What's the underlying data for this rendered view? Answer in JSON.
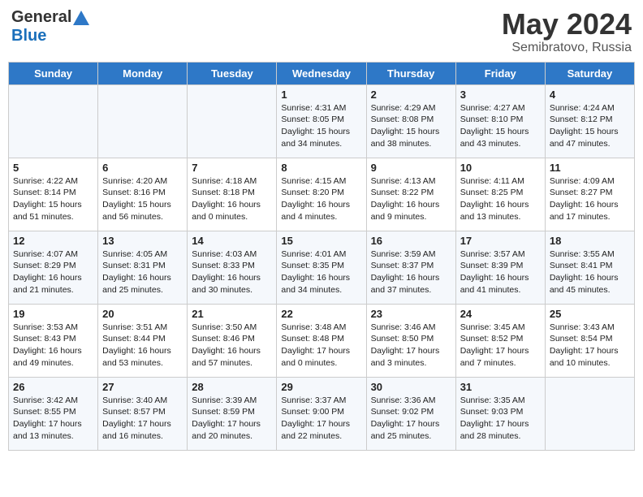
{
  "header": {
    "logo_general": "General",
    "logo_blue": "Blue",
    "month_year": "May 2024",
    "location": "Semibratovo, Russia"
  },
  "days_of_week": [
    "Sunday",
    "Monday",
    "Tuesday",
    "Wednesday",
    "Thursday",
    "Friday",
    "Saturday"
  ],
  "weeks": [
    [
      {
        "day": "",
        "info": ""
      },
      {
        "day": "",
        "info": ""
      },
      {
        "day": "",
        "info": ""
      },
      {
        "day": "1",
        "info": "Sunrise: 4:31 AM\nSunset: 8:05 PM\nDaylight: 15 hours\nand 34 minutes."
      },
      {
        "day": "2",
        "info": "Sunrise: 4:29 AM\nSunset: 8:08 PM\nDaylight: 15 hours\nand 38 minutes."
      },
      {
        "day": "3",
        "info": "Sunrise: 4:27 AM\nSunset: 8:10 PM\nDaylight: 15 hours\nand 43 minutes."
      },
      {
        "day": "4",
        "info": "Sunrise: 4:24 AM\nSunset: 8:12 PM\nDaylight: 15 hours\nand 47 minutes."
      }
    ],
    [
      {
        "day": "5",
        "info": "Sunrise: 4:22 AM\nSunset: 8:14 PM\nDaylight: 15 hours\nand 51 minutes."
      },
      {
        "day": "6",
        "info": "Sunrise: 4:20 AM\nSunset: 8:16 PM\nDaylight: 15 hours\nand 56 minutes."
      },
      {
        "day": "7",
        "info": "Sunrise: 4:18 AM\nSunset: 8:18 PM\nDaylight: 16 hours\nand 0 minutes."
      },
      {
        "day": "8",
        "info": "Sunrise: 4:15 AM\nSunset: 8:20 PM\nDaylight: 16 hours\nand 4 minutes."
      },
      {
        "day": "9",
        "info": "Sunrise: 4:13 AM\nSunset: 8:22 PM\nDaylight: 16 hours\nand 9 minutes."
      },
      {
        "day": "10",
        "info": "Sunrise: 4:11 AM\nSunset: 8:25 PM\nDaylight: 16 hours\nand 13 minutes."
      },
      {
        "day": "11",
        "info": "Sunrise: 4:09 AM\nSunset: 8:27 PM\nDaylight: 16 hours\nand 17 minutes."
      }
    ],
    [
      {
        "day": "12",
        "info": "Sunrise: 4:07 AM\nSunset: 8:29 PM\nDaylight: 16 hours\nand 21 minutes."
      },
      {
        "day": "13",
        "info": "Sunrise: 4:05 AM\nSunset: 8:31 PM\nDaylight: 16 hours\nand 25 minutes."
      },
      {
        "day": "14",
        "info": "Sunrise: 4:03 AM\nSunset: 8:33 PM\nDaylight: 16 hours\nand 30 minutes."
      },
      {
        "day": "15",
        "info": "Sunrise: 4:01 AM\nSunset: 8:35 PM\nDaylight: 16 hours\nand 34 minutes."
      },
      {
        "day": "16",
        "info": "Sunrise: 3:59 AM\nSunset: 8:37 PM\nDaylight: 16 hours\nand 37 minutes."
      },
      {
        "day": "17",
        "info": "Sunrise: 3:57 AM\nSunset: 8:39 PM\nDaylight: 16 hours\nand 41 minutes."
      },
      {
        "day": "18",
        "info": "Sunrise: 3:55 AM\nSunset: 8:41 PM\nDaylight: 16 hours\nand 45 minutes."
      }
    ],
    [
      {
        "day": "19",
        "info": "Sunrise: 3:53 AM\nSunset: 8:43 PM\nDaylight: 16 hours\nand 49 minutes."
      },
      {
        "day": "20",
        "info": "Sunrise: 3:51 AM\nSunset: 8:44 PM\nDaylight: 16 hours\nand 53 minutes."
      },
      {
        "day": "21",
        "info": "Sunrise: 3:50 AM\nSunset: 8:46 PM\nDaylight: 16 hours\nand 57 minutes."
      },
      {
        "day": "22",
        "info": "Sunrise: 3:48 AM\nSunset: 8:48 PM\nDaylight: 17 hours\nand 0 minutes."
      },
      {
        "day": "23",
        "info": "Sunrise: 3:46 AM\nSunset: 8:50 PM\nDaylight: 17 hours\nand 3 minutes."
      },
      {
        "day": "24",
        "info": "Sunrise: 3:45 AM\nSunset: 8:52 PM\nDaylight: 17 hours\nand 7 minutes."
      },
      {
        "day": "25",
        "info": "Sunrise: 3:43 AM\nSunset: 8:54 PM\nDaylight: 17 hours\nand 10 minutes."
      }
    ],
    [
      {
        "day": "26",
        "info": "Sunrise: 3:42 AM\nSunset: 8:55 PM\nDaylight: 17 hours\nand 13 minutes."
      },
      {
        "day": "27",
        "info": "Sunrise: 3:40 AM\nSunset: 8:57 PM\nDaylight: 17 hours\nand 16 minutes."
      },
      {
        "day": "28",
        "info": "Sunrise: 3:39 AM\nSunset: 8:59 PM\nDaylight: 17 hours\nand 20 minutes."
      },
      {
        "day": "29",
        "info": "Sunrise: 3:37 AM\nSunset: 9:00 PM\nDaylight: 17 hours\nand 22 minutes."
      },
      {
        "day": "30",
        "info": "Sunrise: 3:36 AM\nSunset: 9:02 PM\nDaylight: 17 hours\nand 25 minutes."
      },
      {
        "day": "31",
        "info": "Sunrise: 3:35 AM\nSunset: 9:03 PM\nDaylight: 17 hours\nand 28 minutes."
      },
      {
        "day": "",
        "info": ""
      }
    ]
  ]
}
